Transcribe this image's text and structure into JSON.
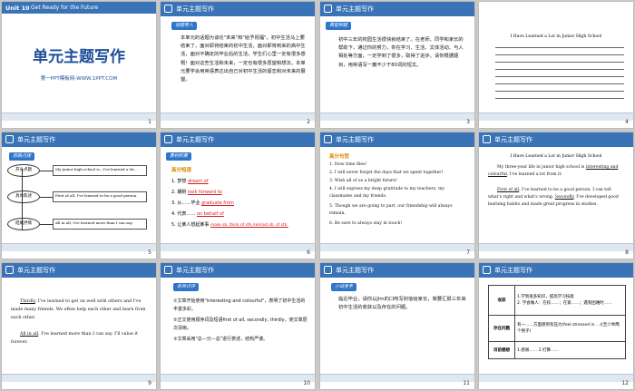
{
  "header_title": "单元主题写作",
  "slide1": {
    "unit": "Unit 10",
    "subtitle": "Get Ready for the Future",
    "title": "单元主题写作",
    "footer": "第一PPT模板网-WWW.1PPT.COM"
  },
  "slide2": {
    "tag": "话题导入",
    "text": "本单元的话题为谈论\"未来\"和\"给予祝福\"。初中生活马上要结束了，面对即将结束的初中生活，面对即将到来的高中生活，面对不确定的毕业后的生活，学生们心里一定有很多感慨！面对这些生活和未来，一定也有很多愿望和想法。本单元要学会用英语表达出自己对初中生活的留恋和对未来的展望。"
  },
  "slide3": {
    "tag": "典型例题",
    "text": "初中三年的校园生活很快就结束了。在老师、同学和家长的帮助下，通过你的努力，你在学习、生活、文体活动、与人相处等方面，一定学到了很多，取得了进步。请你根据题目，用英语写一篇不少于80词的短文。"
  },
  "slide4": {
    "title": "I Have Learned a Lot in Junior High School"
  },
  "slide5": {
    "tag": "思路点拨",
    "labels": [
      "开头点题",
      "具体陈述",
      "结尾抒情"
    ],
    "boxes": [
      "My junior high school is...I've learned a lot...",
      "First of all, I've learned to be a good person.",
      "All in all, I've learned more than I can say."
    ]
  },
  "slide6": {
    "tag": "素材积累",
    "section": "高分短语",
    "items": [
      {
        "n": "1. 梦想",
        "ans": "dream of"
      },
      {
        "n": "2. 期盼",
        "ans": "look forward to"
      },
      {
        "n": "3. 从……毕业",
        "ans": "graduate from"
      },
      {
        "n": "4. 代表……",
        "ans": "on behalf of"
      },
      {
        "n": "5. 让某人想起某事",
        "ans": "make sb. think of sth./remind sb. of sth."
      }
    ]
  },
  "slide7": {
    "section": "高分句型",
    "items": [
      "1. How time flies!",
      "2. I will never forget the days that we spent together!",
      "3. Wish all of us a bright future!",
      "4. I will express my deep gratitude to my teachers, my classmates and my friends.",
      "5. Though we are going to part, our friendship will always remain.",
      "6. Be sure to always stay in touch!"
    ]
  },
  "slide8": {
    "title": "I Have Learned a Lot in Junior High School",
    "p1_a": "My three-year life in junior high school is",
    "p1_u": "interesting and colourful",
    "p1_b": ". I've learned a lot from it.",
    "p2_u1": "First of all",
    "p2_a": ", I've learned to be a good person. I can tell what's right and what's wrong.",
    "p2_u2": "Secondly",
    "p2_b": ", I've developed good learning habits and made great progress in studies."
  },
  "slide9": {
    "p1_u": "Thirdly",
    "p1": ", I've learned to get on well with others and I've made many friends. We often help each other and learn from each other.",
    "p2_u": "All in all",
    "p2": ", I've learned more than I can say. I'll value it forever."
  },
  "slide10": {
    "tag": "名师点评",
    "items": [
      "①文章开始使用\"interesting and colourful\"，表明了初中生活的丰富多彩。",
      "②正文使用顺序词及短语first of all, secondly, thirdly，使文章层次清晰。",
      "③文章采用\"总—分—总\"进行表述，结构严谨。"
    ]
  },
  "slide11": {
    "tag": "小试身手",
    "text": "临近毕业，请你以Jim的口吻写封信给家长，简要汇报三年来初中生活的收获以及存在的问题。"
  },
  "slide12": {
    "rows": [
      {
        "h": "收获",
        "c": "1.学到很多知识，提高学习技能\n2. 学会做人：在校……；在家……；遇到困难时……"
      },
      {
        "h": "存在问题",
        "c": "有一……方面感到有压力(feel stressed in ...)(至少举两个例子)"
      },
      {
        "h": "目前感想",
        "c": "1.感谢……  2.打算……"
      }
    ]
  },
  "numbers": [
    "1",
    "2",
    "3",
    "4",
    "5",
    "6",
    "7",
    "8",
    "9",
    "10",
    "11",
    "12"
  ]
}
